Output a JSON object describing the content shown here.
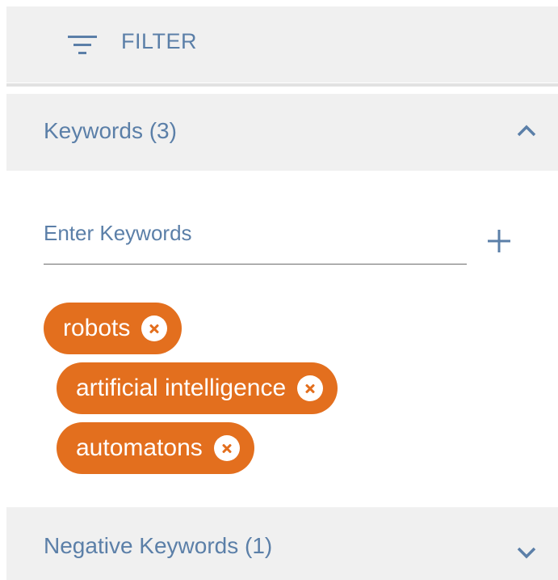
{
  "filter": {
    "label": "FILTER",
    "icon": "filter-list-icon"
  },
  "keywords": {
    "header_title": "Keywords (3)",
    "input_placeholder": "Enter Keywords",
    "input_value": "",
    "chips": [
      {
        "label": "robots"
      },
      {
        "label": "artificial intelligence"
      },
      {
        "label": "automatons"
      }
    ]
  },
  "negative_keywords": {
    "header_title": "Negative Keywords (1)"
  },
  "colors": {
    "accent_text": "#5b7fa8",
    "chip_bg": "#e36f1e",
    "header_bg": "#f0f0f0"
  }
}
